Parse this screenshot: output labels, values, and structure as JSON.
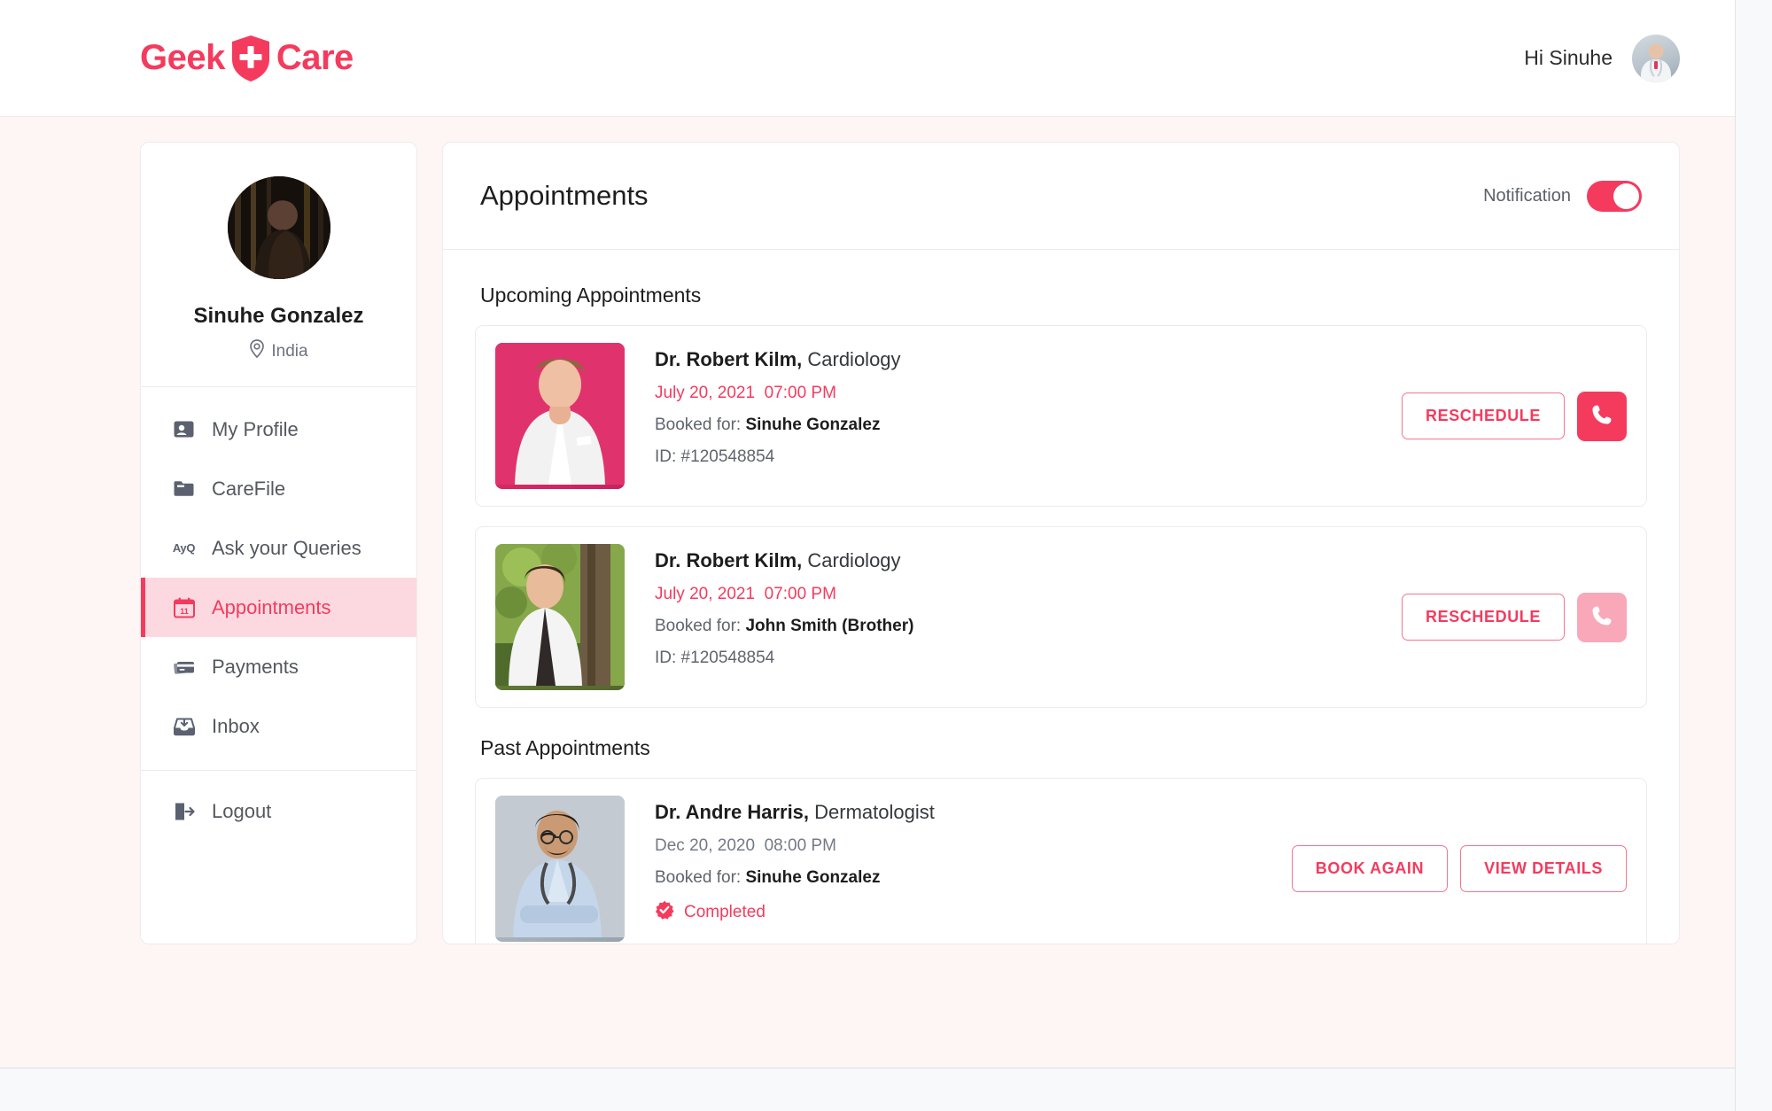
{
  "header": {
    "logo_left": "Geek",
    "logo_right": "Care",
    "logo_icon": "shield-plus-icon",
    "greeting": "Hi Sinuhe",
    "avatar_icon": "user-avatar"
  },
  "sidebar": {
    "profile": {
      "name": "Sinuhe Gonzalez",
      "location": "India",
      "location_icon": "map-pin-icon",
      "avatar_icon": "profile-photo"
    },
    "items": [
      {
        "label": "My Profile",
        "icon": "user-card-icon",
        "active": false
      },
      {
        "label": "CareFile",
        "icon": "folder-icon",
        "active": false
      },
      {
        "label": "Ask your Queries",
        "icon": "ayq-text-icon",
        "active": false,
        "icon_text": "AyQ"
      },
      {
        "label": "Appointments",
        "icon": "calendar-icon",
        "active": true,
        "icon_text": "11"
      },
      {
        "label": "Payments",
        "icon": "credit-card-icon",
        "active": false
      },
      {
        "label": "Inbox",
        "icon": "inbox-icon",
        "active": false
      }
    ],
    "logout": {
      "label": "Logout",
      "icon": "logout-icon"
    }
  },
  "main": {
    "title": "Appointments",
    "notification_label": "Notification",
    "notification_on": true,
    "upcoming_title": "Upcoming Appointments",
    "past_title": "Past Appointments",
    "upcoming": [
      {
        "doctor_name": "Dr. Robert Kilm,",
        "specialty": "Cardiology",
        "date": "July 20, 2021",
        "time": "07:00 PM",
        "booked_for_label": "Booked for:",
        "booked_for": "Sinuhe Gonzalez",
        "id": "ID: #120548854",
        "reschedule_label": "RESCHEDULE",
        "call_icon": "phone-icon",
        "call_enabled": true,
        "photo": "doctor-photo-pink-bg"
      },
      {
        "doctor_name": "Dr. Robert Kilm,",
        "specialty": "Cardiology",
        "date": "July 20, 2021",
        "time": "07:00 PM",
        "booked_for_label": "Booked for:",
        "booked_for": "John Smith (Brother)",
        "id": "ID: #120548854",
        "reschedule_label": "RESCHEDULE",
        "call_icon": "phone-icon",
        "call_enabled": false,
        "photo": "doctor-photo-outdoor-bg"
      }
    ],
    "past": [
      {
        "doctor_name": "Dr. Andre Harris,",
        "specialty": "Dermatologist",
        "date": "Dec 20, 2020",
        "time": "08:00 PM",
        "booked_for_label": "Booked for:",
        "booked_for": "Sinuhe Gonzalez",
        "status": "Completed",
        "status_icon": "verified-check-icon",
        "book_again_label": "BOOK AGAIN",
        "view_details_label": "VIEW DETAILS",
        "photo": "doctor-photo-gray-bg"
      }
    ]
  },
  "colors": {
    "accent": "#f43b5e",
    "accent_light": "#fcd9e0",
    "page_bg": "#fef5f5",
    "card_bg": "#ffffff",
    "muted_call": "#f8a8b9"
  }
}
